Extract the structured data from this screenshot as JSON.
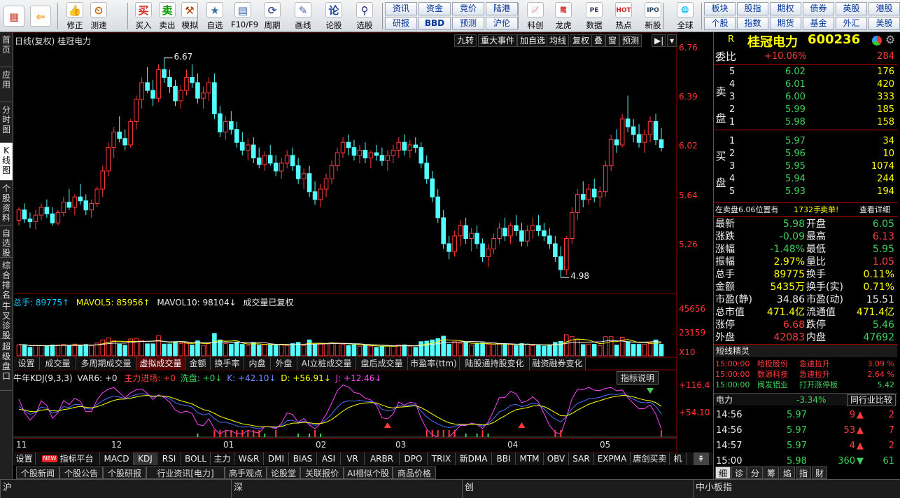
{
  "toolbar": {
    "buttons": [
      {
        "name": "home-button",
        "icon": "grid-icon",
        "label": ""
      },
      {
        "name": "back-button",
        "icon": "back-arrow-icon",
        "label": ""
      },
      {
        "name": "fix-button",
        "icon": "thumbs-icon",
        "label": "修正"
      },
      {
        "name": "test-button",
        "icon": "clock-icon",
        "label": "测速"
      },
      {
        "name": "buy-button",
        "icon": "buy-icon",
        "label": "买入"
      },
      {
        "name": "sell-button",
        "icon": "sell-icon",
        "label": "卖出"
      },
      {
        "name": "simulate-button",
        "icon": "hammer-icon",
        "label": "模拟"
      },
      {
        "name": "watchlist-button",
        "icon": "star-icon",
        "label": "自选"
      },
      {
        "name": "f10-button",
        "icon": "window-icon",
        "label": "F10/F9"
      },
      {
        "name": "period-button",
        "icon": "cycle-icon",
        "label": "周期"
      },
      {
        "name": "draw-button",
        "icon": "pencil-icon",
        "label": "画线"
      },
      {
        "name": "forum-button",
        "icon": "forum-icon",
        "label": "论股"
      },
      {
        "name": "pick-button",
        "icon": "magnify-icon",
        "label": "选股"
      }
    ],
    "grid_buttons_row1": [
      "资讯",
      "资金",
      "竞价",
      "陆港"
    ],
    "grid_buttons_row2": [
      "研报",
      "BBD",
      "预测",
      "沪伦"
    ],
    "big_buttons": [
      {
        "name": "kechuang-button",
        "label": "科创"
      },
      {
        "name": "dragon-button",
        "label": "龙虎"
      },
      {
        "name": "data-button",
        "label": "数据"
      },
      {
        "name": "hot-button",
        "label": "热点"
      },
      {
        "name": "ipo-button",
        "label": "新股"
      },
      {
        "name": "global-button",
        "label": "全球"
      }
    ],
    "right_row1": [
      "板块",
      "股指",
      "期权",
      "债券",
      "英股",
      "港股"
    ],
    "right_row2": [
      "个股",
      "指数",
      "期货",
      "基金",
      "外汇",
      "美股"
    ]
  },
  "left_tabs": [
    "首页",
    "应用",
    "分时图",
    "K线图",
    "个股资料",
    "自选股",
    "综合排名",
    "牛叉诊股",
    "超级盘口"
  ],
  "chart": {
    "title": "日线(复权)  桂冠电力",
    "tools": [
      "九转",
      "重大事件",
      "加自选",
      "均线",
      "复权",
      "叠",
      "窗",
      "预测"
    ],
    "price_ticks": [
      "6.76",
      "6.39",
      "6.02",
      "5.64",
      "5.26"
    ],
    "high_label": "6.67",
    "low_label": "4.98",
    "volume_header": {
      "total": "总手: 89775↑",
      "mavol5": "MAVOL5: 85956↑",
      "mavol10": "MAVOL10: 98104↓",
      "note": "成交量已复权"
    },
    "volume_ticks": [
      "45656",
      "23159",
      "X10"
    ],
    "volume_tabs": [
      "设置",
      "成交量",
      "多周期成交量",
      "虚拟成交量",
      "金额",
      "换手率",
      "内盘",
      "外盘",
      "AI立桩成交量",
      "盘后成交量",
      "市盈率(ttm)",
      "陆股通持股变化",
      "融资融券变化"
    ],
    "kdj_header": {
      "name": "牛年KDJ(9,3,3)",
      "var6": "VAR6: +0",
      "main": "主力进场: +0",
      "wash": "洗盘: +0↓",
      "k": "K: +42.10↓",
      "d": "D: +56.91↓",
      "j": "J: +12.46↓",
      "help": "指标说明"
    },
    "kdj_ticks": [
      "+116.4",
      "+54.10"
    ],
    "months": [
      "11",
      "12",
      "01",
      "02",
      "03",
      "04",
      "05"
    ],
    "indicator_tabs": [
      "设置",
      "指标平台",
      "MACD",
      "KDJ",
      "RSI",
      "BOLL",
      "主力",
      "W&R",
      "DMI",
      "BIAS",
      "ASI",
      "VR",
      "ARBR",
      "DPO",
      "TRIX",
      "新DMA",
      "BBI",
      "MTM",
      "OBV",
      "SAR",
      "EXPMA",
      "唐剑买卖",
      "机"
    ],
    "new_badge": "NEW",
    "news_tabs": [
      "个股新闻",
      "个股公告",
      "个股研报",
      "行业资讯[电力]",
      "高手观点",
      "论股堂",
      "关联报价",
      "AI相似个股",
      "商品价格"
    ]
  },
  "quote": {
    "r_label": "R",
    "name": "桂冠电力",
    "code": "600236",
    "weibi_label": "委比",
    "weibi_value": "+10.06%",
    "weibi_count": "284",
    "sell_label": "卖盘",
    "buy_label": "买盘",
    "asks": [
      {
        "lvl": "5",
        "price": "6.02",
        "vol": "176"
      },
      {
        "lvl": "4",
        "price": "6.01",
        "vol": "420"
      },
      {
        "lvl": "3",
        "price": "6.00",
        "vol": "333"
      },
      {
        "lvl": "2",
        "price": "5.99",
        "vol": "185"
      },
      {
        "lvl": "1",
        "price": "5.98",
        "vol": "158"
      }
    ],
    "bids": [
      {
        "lvl": "1",
        "price": "5.97",
        "vol": "34"
      },
      {
        "lvl": "2",
        "price": "5.96",
        "vol": "10"
      },
      {
        "lvl": "3",
        "price": "5.95",
        "vol": "1074"
      },
      {
        "lvl": "4",
        "price": "5.94",
        "vol": "244"
      },
      {
        "lvl": "5",
        "price": "5.93",
        "vol": "194"
      }
    ],
    "info_line": {
      "left": "在卖盘6.06位置有",
      "count": "1732手",
      "tag": "卖单!",
      "link": "查看详细"
    },
    "stats": [
      {
        "l1": "最新",
        "v1": "5.98",
        "c1": "green",
        "l2": "开盘",
        "v2": "6.05",
        "c2": "green"
      },
      {
        "l1": "涨跌",
        "v1": "-0.09",
        "c1": "green",
        "l2": "最高",
        "v2": "6.13",
        "c2": "red"
      },
      {
        "l1": "涨幅",
        "v1": "-1.48%",
        "c1": "green",
        "l2": "最低",
        "v2": "5.95",
        "c2": "green"
      },
      {
        "l1": "振幅",
        "v1": "2.97%",
        "c1": "yellow",
        "l2": "量比",
        "v2": "1.05",
        "c2": "red"
      },
      {
        "l1": "总手",
        "v1": "89775",
        "c1": "yellow",
        "l2": "换手",
        "v2": "0.11%",
        "c2": "yellow"
      },
      {
        "l1": "金额",
        "v1": "5435万",
        "c1": "yellow",
        "l2": "换手(实)",
        "v2": "0.71%",
        "c2": "yellow"
      },
      {
        "l1": "市盈(静)",
        "v1": "34.86",
        "c1": "white",
        "l2": "市盈(动)",
        "v2": "15.51",
        "c2": "white"
      },
      {
        "l1": "总市值",
        "v1": "471.4亿",
        "c1": "yellow",
        "l2": "流通值",
        "v2": "471.4亿",
        "c2": "yellow"
      },
      {
        "l1": "涨停",
        "v1": "6.68",
        "c1": "red",
        "l2": "跌停",
        "v2": "5.46",
        "c2": "green"
      },
      {
        "l1": "外盘",
        "v1": "42083",
        "c1": "red",
        "l2": "内盘",
        "v2": "47692",
        "c2": "green"
      }
    ],
    "short_title": "短线精灵",
    "short_items": [
      {
        "time": "15:00:00",
        "name": "哈投股份",
        "event": "急速拉升",
        "val": "3.09 %",
        "cls": "red"
      },
      {
        "time": "15:00:00",
        "name": "数源科技",
        "event": "急速拉升",
        "val": "2.64 %",
        "cls": "red"
      },
      {
        "time": "15:00:00",
        "name": "闽发铝业",
        "event": "打开涨停板",
        "val": "5.42",
        "cls": "green"
      }
    ],
    "sector": {
      "name": "电力",
      "chg": "-3.34%",
      "compare": "同行业比较"
    },
    "ticks": [
      {
        "time": "14:56",
        "price": "5.97",
        "vol": "9",
        "dir": "up",
        "n": "2"
      },
      {
        "time": "14:56",
        "price": "5.97",
        "vol": "53",
        "dir": "up",
        "n": "7"
      },
      {
        "time": "14:57",
        "price": "5.97",
        "vol": "4",
        "dir": "up",
        "n": "2"
      },
      {
        "time": "15:00",
        "price": "5.98",
        "vol": "360",
        "dir": "down",
        "n": "61"
      }
    ],
    "bottom_tabs": [
      "细",
      "诊",
      "分",
      "筹",
      "焰",
      "指",
      "财"
    ]
  },
  "status": [
    "沪",
    "深",
    "创",
    "中小板指"
  ],
  "colors": {
    "up": "#ff3b3b",
    "down": "#54ffff",
    "bg": "#000000",
    "accent": "#ffff00"
  },
  "chart_data": {
    "type": "candlestick",
    "ylim": [
      4.9,
      6.76
    ],
    "high": 6.67,
    "low": 4.98,
    "candles": [
      [
        5.42,
        5.52,
        5.38,
        5.5
      ],
      [
        5.5,
        5.55,
        5.4,
        5.43
      ],
      [
        5.43,
        5.48,
        5.36,
        5.41
      ],
      [
        5.41,
        5.5,
        5.35,
        5.46
      ],
      [
        5.46,
        5.55,
        5.42,
        5.52
      ],
      [
        5.52,
        5.58,
        5.44,
        5.47
      ],
      [
        5.47,
        5.52,
        5.38,
        5.4
      ],
      [
        5.4,
        5.5,
        5.38,
        5.48
      ],
      [
        5.48,
        5.6,
        5.45,
        5.56
      ],
      [
        5.56,
        5.66,
        5.5,
        5.52
      ],
      [
        5.52,
        5.62,
        5.46,
        5.6
      ],
      [
        5.6,
        5.7,
        5.54,
        5.57
      ],
      [
        5.57,
        5.62,
        5.46,
        5.5
      ],
      [
        5.5,
        5.58,
        5.44,
        5.55
      ],
      [
        5.55,
        5.68,
        5.52,
        5.66
      ],
      [
        5.66,
        5.84,
        5.6,
        5.8
      ],
      [
        5.8,
        6.02,
        5.76,
        5.98
      ],
      [
        5.98,
        6.14,
        5.9,
        6.1
      ],
      [
        6.1,
        6.22,
        6.02,
        6.05
      ],
      [
        6.05,
        6.12,
        5.96,
        6.0
      ],
      [
        6.0,
        6.2,
        5.98,
        6.18
      ],
      [
        6.18,
        6.38,
        6.12,
        6.35
      ],
      [
        6.35,
        6.52,
        6.28,
        6.48
      ],
      [
        6.48,
        6.6,
        6.4,
        6.42
      ],
      [
        6.42,
        6.5,
        6.3,
        6.36
      ],
      [
        6.36,
        6.62,
        6.33,
        6.58
      ],
      [
        6.58,
        6.67,
        6.48,
        6.52
      ],
      [
        6.52,
        6.58,
        6.4,
        6.45
      ],
      [
        6.45,
        6.5,
        6.3,
        6.34
      ],
      [
        6.34,
        6.46,
        6.28,
        6.42
      ],
      [
        6.42,
        6.58,
        6.38,
        6.52
      ],
      [
        6.52,
        6.62,
        6.44,
        6.48
      ],
      [
        6.48,
        6.55,
        6.32,
        6.36
      ],
      [
        6.36,
        6.45,
        6.28,
        6.4
      ],
      [
        6.4,
        6.52,
        6.34,
        6.48
      ],
      [
        6.48,
        6.55,
        6.2,
        6.24
      ],
      [
        6.24,
        6.3,
        6.06,
        6.1
      ],
      [
        6.1,
        6.22,
        6.04,
        6.18
      ],
      [
        6.18,
        6.26,
        6.08,
        6.12
      ],
      [
        6.12,
        6.18,
        5.98,
        6.02
      ],
      [
        6.02,
        6.1,
        5.92,
        5.96
      ],
      [
        5.96,
        6.05,
        5.88,
        6.0
      ],
      [
        6.0,
        6.06,
        5.86,
        5.9
      ],
      [
        5.9,
        5.98,
        5.82,
        5.85
      ],
      [
        5.85,
        5.95,
        5.8,
        5.92
      ],
      [
        5.92,
        6.0,
        5.84,
        5.86
      ],
      [
        5.86,
        5.92,
        5.76,
        5.8
      ],
      [
        5.8,
        5.9,
        5.74,
        5.86
      ],
      [
        5.86,
        5.96,
        5.82,
        5.92
      ],
      [
        5.92,
        5.98,
        5.8,
        5.84
      ],
      [
        5.84,
        5.9,
        5.7,
        5.74
      ],
      [
        5.74,
        5.82,
        5.66,
        5.78
      ],
      [
        5.78,
        5.84,
        5.6,
        5.64
      ],
      [
        5.64,
        5.72,
        5.54,
        5.58
      ],
      [
        5.58,
        5.7,
        5.52,
        5.66
      ],
      [
        5.66,
        5.78,
        5.6,
        5.74
      ],
      [
        5.74,
        5.88,
        5.7,
        5.84
      ],
      [
        5.84,
        5.98,
        5.8,
        5.94
      ],
      [
        5.94,
        6.06,
        5.9,
        6.02
      ],
      [
        6.02,
        6.08,
        5.92,
        5.98
      ],
      [
        5.98,
        6.04,
        5.88,
        5.92
      ],
      [
        5.92,
        6.0,
        5.86,
        5.96
      ],
      [
        5.96,
        6.02,
        5.86,
        5.9
      ],
      [
        5.9,
        5.96,
        5.82,
        5.94
      ],
      [
        5.94,
        6.0,
        5.88,
        5.92
      ],
      [
        5.92,
        5.98,
        5.84,
        5.88
      ],
      [
        5.88,
        5.96,
        5.8,
        5.92
      ],
      [
        5.92,
        6.0,
        5.86,
        5.96
      ],
      [
        5.96,
        6.06,
        5.9,
        6.02
      ],
      [
        6.02,
        6.08,
        5.92,
        5.96
      ],
      [
        5.96,
        6.04,
        5.9,
        6.0
      ],
      [
        6.0,
        6.06,
        5.94,
        5.98
      ],
      [
        5.98,
        6.02,
        5.82,
        5.86
      ],
      [
        5.86,
        5.92,
        5.7,
        5.74
      ],
      [
        5.74,
        5.8,
        5.56,
        5.6
      ],
      [
        5.6,
        5.66,
        5.4,
        5.44
      ],
      [
        5.44,
        5.5,
        5.2,
        5.24
      ],
      [
        5.24,
        5.3,
        5.12,
        5.18
      ],
      [
        5.18,
        5.34,
        5.14,
        5.3
      ],
      [
        5.3,
        5.42,
        5.22,
        5.38
      ],
      [
        5.38,
        5.44,
        5.24,
        5.28
      ],
      [
        5.28,
        5.36,
        5.18,
        5.32
      ],
      [
        5.32,
        5.38,
        5.2,
        5.24
      ],
      [
        5.24,
        5.28,
        5.1,
        5.14
      ],
      [
        5.14,
        5.24,
        5.06,
        5.2
      ],
      [
        5.2,
        5.32,
        5.16,
        5.28
      ],
      [
        5.28,
        5.4,
        5.24,
        5.36
      ],
      [
        5.36,
        5.44,
        5.26,
        5.3
      ],
      [
        5.3,
        5.4,
        5.24,
        5.38
      ],
      [
        5.38,
        5.46,
        5.3,
        5.34
      ],
      [
        5.34,
        5.4,
        5.22,
        5.26
      ],
      [
        5.26,
        5.38,
        5.22,
        5.34
      ],
      [
        5.34,
        5.44,
        5.28,
        5.38
      ],
      [
        5.38,
        5.46,
        5.3,
        5.34
      ],
      [
        5.34,
        5.4,
        5.26,
        5.3
      ],
      [
        5.3,
        5.36,
        5.2,
        5.24
      ],
      [
        5.24,
        5.3,
        5.1,
        5.14
      ],
      [
        5.14,
        5.22,
        4.98,
        5.04
      ],
      [
        5.04,
        5.3,
        5.0,
        5.28
      ],
      [
        5.28,
        5.52,
        5.24,
        5.48
      ],
      [
        5.48,
        5.66,
        5.42,
        5.62
      ],
      [
        5.62,
        5.72,
        5.52,
        5.58
      ],
      [
        5.58,
        5.7,
        5.54,
        5.66
      ],
      [
        5.66,
        5.74,
        5.56,
        5.6
      ],
      [
        5.6,
        5.68,
        5.52,
        5.64
      ],
      [
        5.64,
        5.88,
        5.6,
        5.84
      ],
      [
        5.84,
        6.08,
        5.8,
        6.04
      ],
      [
        6.04,
        6.12,
        5.94,
        6.0
      ],
      [
        6.0,
        6.24,
        5.98,
        6.2
      ],
      [
        6.2,
        6.38,
        6.1,
        6.14
      ],
      [
        6.14,
        6.2,
        6.02,
        6.08
      ],
      [
        6.08,
        6.16,
        5.98,
        6.02
      ],
      [
        6.02,
        6.12,
        5.94,
        6.08
      ],
      [
        6.08,
        6.22,
        6.02,
        6.18
      ],
      [
        6.18,
        6.24,
        6.0,
        6.04
      ],
      [
        6.04,
        6.13,
        5.95,
        5.98
      ]
    ]
  }
}
